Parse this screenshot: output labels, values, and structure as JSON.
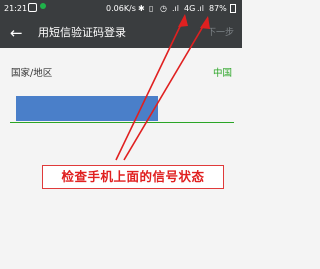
{
  "status_bar": {
    "time": "21:21",
    "speed": "0.06K/s",
    "network": "4G",
    "battery": "87%"
  },
  "app_bar": {
    "back_icon": "arrow-left-icon",
    "title": "用短信验证码登录",
    "next_label": "下一步"
  },
  "form": {
    "country_label": "国家/地区",
    "country_value": "中国"
  },
  "annotation": {
    "text": "检查手机上面的信号状态"
  },
  "colors": {
    "bar_bg": "#3a3d3f",
    "accent_green": "#2aa526",
    "annotation_red": "#e02020",
    "redaction_blue": "#4a7fc9"
  }
}
